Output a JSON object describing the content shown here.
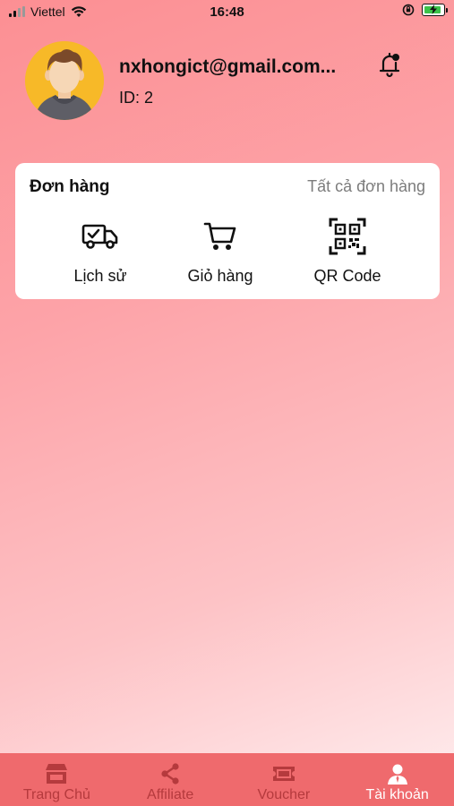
{
  "status_bar": {
    "carrier": "Viettel",
    "time": "16:48"
  },
  "profile": {
    "email": "nxhongict@gmail.com...",
    "id_text": "ID: 2"
  },
  "orders": {
    "title": "Đơn hàng",
    "view_all": "Tất cả đơn hàng",
    "actions": [
      {
        "label": "Lịch sử",
        "icon": "delivery-truck-icon"
      },
      {
        "label": "Giỏ hàng",
        "icon": "shopping-cart-icon"
      },
      {
        "label": "QR Code",
        "icon": "qr-code-icon"
      }
    ]
  },
  "bottom_nav": {
    "items": [
      {
        "label": "Trang Chủ",
        "icon": "store-icon"
      },
      {
        "label": "Affiliate",
        "icon": "share-icon"
      },
      {
        "label": "Voucher",
        "icon": "ticket-icon"
      },
      {
        "label": "Tài khoản",
        "icon": "user-icon",
        "active": true
      }
    ]
  },
  "colors": {
    "accent": "#ef6a6d",
    "nav_inactive": "#b53a3d",
    "nav_active": "#ffffff"
  }
}
